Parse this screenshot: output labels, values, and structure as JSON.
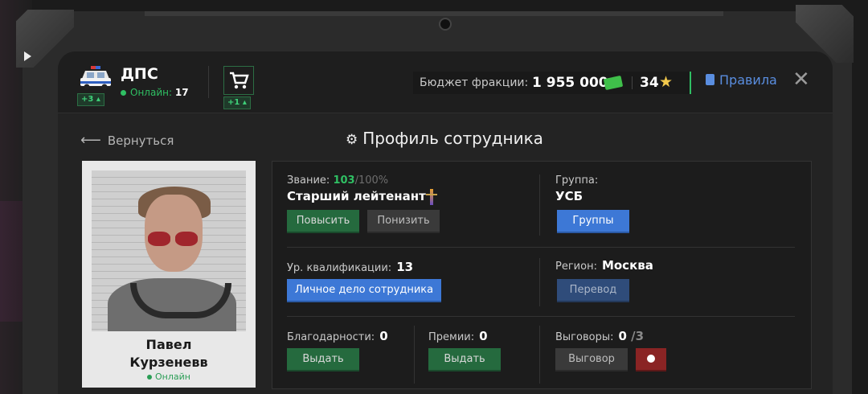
{
  "header": {
    "faction_name": "ДПС",
    "online_label": "Онлайн:",
    "online_count": "17",
    "faction_badge": "+3",
    "cart_badge": "+1",
    "budget_label": "Бюджет фракции:",
    "budget_value": "1 955 000",
    "stars_value": "34",
    "rules_label": "Правила",
    "close": "✕"
  },
  "nav": {
    "back_label": "Вернуться",
    "page_title": "Профиль сотрудника"
  },
  "employee": {
    "first_name": "Павел",
    "last_name": "Курзеневв",
    "status": "Онлайн"
  },
  "rank": {
    "label": "Звание:",
    "progress": "103",
    "max": "/100%",
    "title": "Старший лейтенант",
    "promote": "Повысить",
    "demote": "Понизить"
  },
  "group": {
    "label": "Группа:",
    "value": "УСБ",
    "button": "Группы"
  },
  "qualification": {
    "label": "Ур. квалификации:",
    "value": "13",
    "button": "Личное дело сотрудника"
  },
  "region": {
    "label": "Регион:",
    "value": "Москва",
    "button": "Перевод"
  },
  "thanks": {
    "label": "Благодарности:",
    "value": "0",
    "button": "Выдать"
  },
  "bonuses": {
    "label": "Премии:",
    "value": "0",
    "button": "Выдать"
  },
  "reprimands": {
    "label": "Выговоры:",
    "value": "0",
    "max": "/3",
    "button": "Выговор"
  },
  "colors": {
    "accent_green": "#2fbf63",
    "accent_blue": "#3d78d6",
    "danger_red": "#8a2424"
  }
}
